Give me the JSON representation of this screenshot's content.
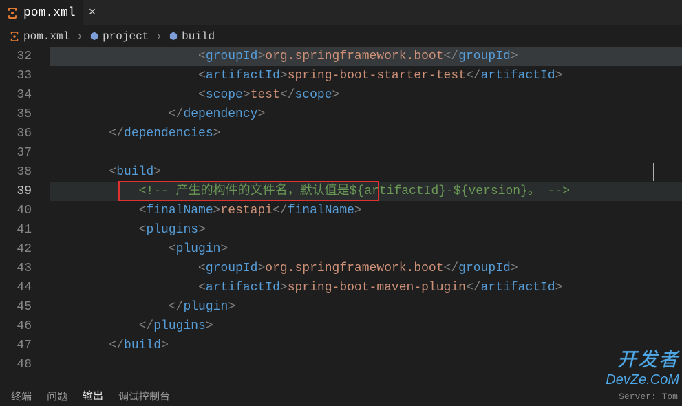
{
  "tab": {
    "filename": "pom.xml",
    "close": "×"
  },
  "breadcrumbs": {
    "file": "pom.xml",
    "p1": "project",
    "p2": "build",
    "sep": "›"
  },
  "gutter": [
    "32",
    "33",
    "34",
    "35",
    "36",
    "37",
    "38",
    "39",
    "40",
    "41",
    "42",
    "43",
    "44",
    "45",
    "46",
    "47",
    "48"
  ],
  "active_line_idx": 7,
  "code": {
    "l32": {
      "pre": "                    ",
      "open": "<groupId>",
      "val": "org.springframework.boot",
      "close": "</groupId>"
    },
    "l33": {
      "pre": "                    ",
      "open": "<artifactId>",
      "val": "spring-boot-starter-test",
      "close": "</artifactId>"
    },
    "l34": {
      "pre": "                    ",
      "open": "<scope>",
      "val": "test",
      "close": "</scope>"
    },
    "l35": {
      "pre": "                ",
      "close": "</dependency>"
    },
    "l36": {
      "pre": "        ",
      "close": "</dependencies>"
    },
    "l38": {
      "pre": "        ",
      "open": "<build>"
    },
    "l39": {
      "pre": "            ",
      "cmt": "<!-- 产生的构件的文件名，默认值是${artifactId}-${version}。 -->"
    },
    "l40": {
      "pre": "            ",
      "open": "<finalName>",
      "val": "restapi",
      "close": "</finalName>"
    },
    "l41": {
      "pre": "            ",
      "open": "<plugins>"
    },
    "l42": {
      "pre": "                ",
      "open": "<plugin>"
    },
    "l43": {
      "pre": "                    ",
      "open": "<groupId>",
      "val": "org.springframework.boot",
      "close": "</groupId>"
    },
    "l44": {
      "pre": "                    ",
      "open": "<artifactId>",
      "val": "spring-boot-maven-plugin",
      "close": "</artifactId>"
    },
    "l45": {
      "pre": "                ",
      "close": "</plugin>"
    },
    "l46": {
      "pre": "            ",
      "close": "</plugins>"
    },
    "l47": {
      "pre": "        ",
      "close": "</build>"
    }
  },
  "bottom_tabs": {
    "terminal": "终端",
    "problems": "问题",
    "output": "输出",
    "debug": "调试控制台"
  },
  "server": "Server: Tom",
  "watermark": {
    "l1": "开发者",
    "l2": "DevZe.CoM"
  }
}
